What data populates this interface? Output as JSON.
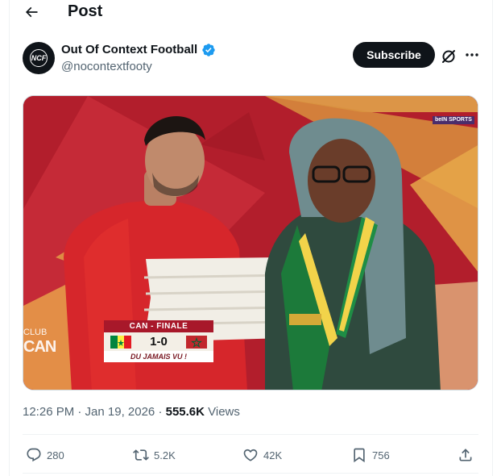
{
  "header": {
    "title": "Post"
  },
  "author": {
    "display_name": "Out Of Context Football",
    "handle": "@nocontextfooty",
    "avatar_text": "NCF",
    "verified": true
  },
  "buttons": {
    "subscribe_label": "Subscribe"
  },
  "media": {
    "scoreboard": {
      "title": "CAN - FINALE",
      "score": "1-0",
      "caption": "DU JAMAIS VU !"
    },
    "overlay_line1": "CLUB",
    "overlay_line2": "CAN",
    "broadcaster": "beIN SPORTS"
  },
  "meta": {
    "time_date": "12:26 PM · Jan 19, 2026 · ",
    "views_count": "555.6K",
    "views_label": " Views"
  },
  "stats": {
    "replies": "280",
    "reposts": "5.2K",
    "likes": "42K",
    "bookmarks": "756"
  },
  "colors": {
    "text_primary": "#0f1419",
    "text_secondary": "#536471",
    "verified_blue": "#1d9bf0",
    "divider": "#eff3f4"
  },
  "icons": {
    "back": "arrow-left-icon",
    "verified": "verified-badge-icon",
    "grok": "grok-icon",
    "more": "more-icon",
    "reply": "reply-icon",
    "repost": "repost-icon",
    "like": "heart-icon",
    "bookmark": "bookmark-icon",
    "share": "share-icon"
  }
}
